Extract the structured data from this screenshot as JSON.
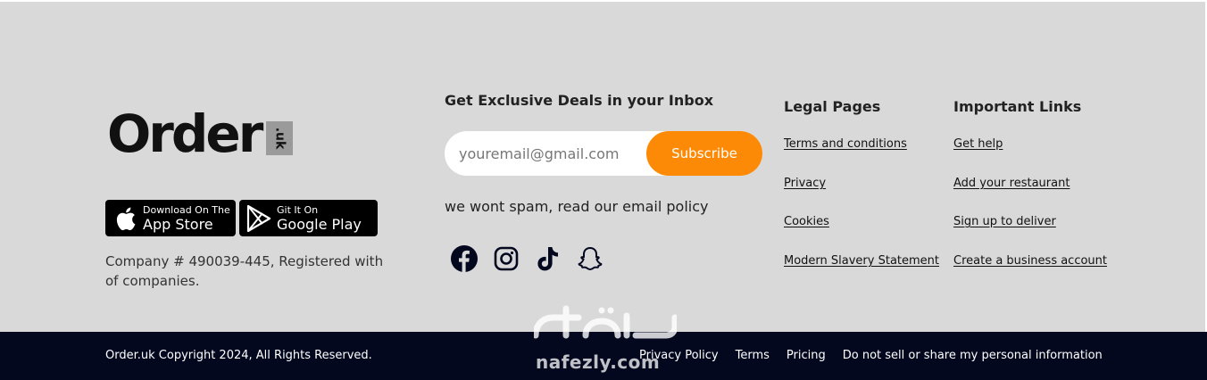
{
  "brand": {
    "logo_text": "Order",
    "logo_badge": ".uk"
  },
  "apps": {
    "app_store": {
      "small": "Download On The",
      "big": "App Store"
    },
    "google_play": {
      "small": "Git It On",
      "big": "Google Play"
    }
  },
  "company_info": "Company # 490039-445, Registered with of companies.",
  "newsletter": {
    "title": "Get Exclusive Deals in your Inbox",
    "email_placeholder": "youremail@gmail.com",
    "subscribe_label": "Subscribe",
    "note": "we wont spam, read our email policy"
  },
  "socials": [
    "facebook-icon",
    "instagram-icon",
    "tiktok-icon",
    "snapchat-icon"
  ],
  "legal": {
    "title": "Legal Pages",
    "links": [
      "Terms and conditions",
      "Privacy",
      "Cookies",
      "Modern Slavery Statement"
    ]
  },
  "important": {
    "title": "Important Links",
    "links": [
      "Get help",
      "Add your restaurant",
      "Sign up to deliver",
      "Create a business account"
    ]
  },
  "bottom": {
    "copyright": "Order.uk Copyright 2024, All Rights Reserved.",
    "links": [
      "Privacy Policy",
      "Terms",
      "Pricing",
      "Do not sell or share my personal information"
    ]
  },
  "watermark": "nafezly.com",
  "colors": {
    "accent": "#fc8a06",
    "footer_bg": "#d9d9d9",
    "bottom_bar": "#03081f"
  }
}
